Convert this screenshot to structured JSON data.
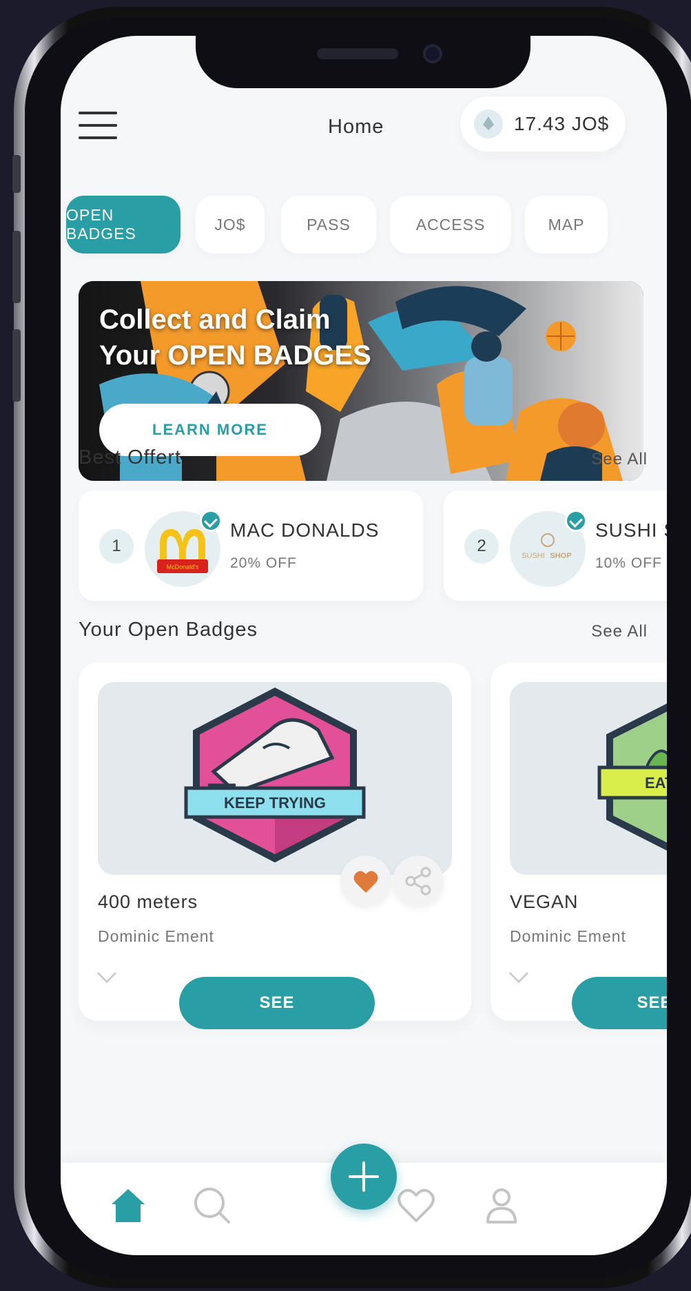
{
  "header": {
    "title": "Home",
    "balance": "17.43 JO$"
  },
  "tabs": [
    {
      "label": "OPEN BADGES",
      "active": true
    },
    {
      "label": "JO$",
      "active": false
    },
    {
      "label": "PASS",
      "active": false
    },
    {
      "label": "ACCESS",
      "active": false
    },
    {
      "label": "MAP",
      "active": false
    }
  ],
  "banner": {
    "title": "Collect and Claim\nYour OPEN BADGES",
    "button": "LEARN MORE"
  },
  "best_offers": {
    "title": "Best Offert",
    "see_all": "See All",
    "items": [
      {
        "rank": "1",
        "name": "MAC DONALDS",
        "discount": "20% OFF",
        "logo_text": "McDonald's"
      },
      {
        "rank": "2",
        "name": "SUSHI SHOP",
        "discount": "10% OFF",
        "logo_text_a": "SUSHI",
        "logo_text_b": "SHOP"
      }
    ]
  },
  "badges": {
    "title": "Your Open Badges",
    "see_all": "See All",
    "items": [
      {
        "name": "400 meters",
        "author": "Dominic Ement",
        "ribbon": "KEEP TRYING",
        "button": "SEE"
      },
      {
        "name": "VEGAN",
        "author": "Dominic Ement",
        "ribbon": "EAT",
        "button": "SEE"
      }
    ]
  },
  "colors": {
    "accent": "#2a9ea5",
    "background": "#f6f7f8",
    "favorite": "#e07a3a"
  },
  "nav": {
    "items": [
      "home-icon",
      "search-icon",
      "add-icon",
      "heart-icon",
      "profile-icon"
    ],
    "active": "home-icon"
  }
}
